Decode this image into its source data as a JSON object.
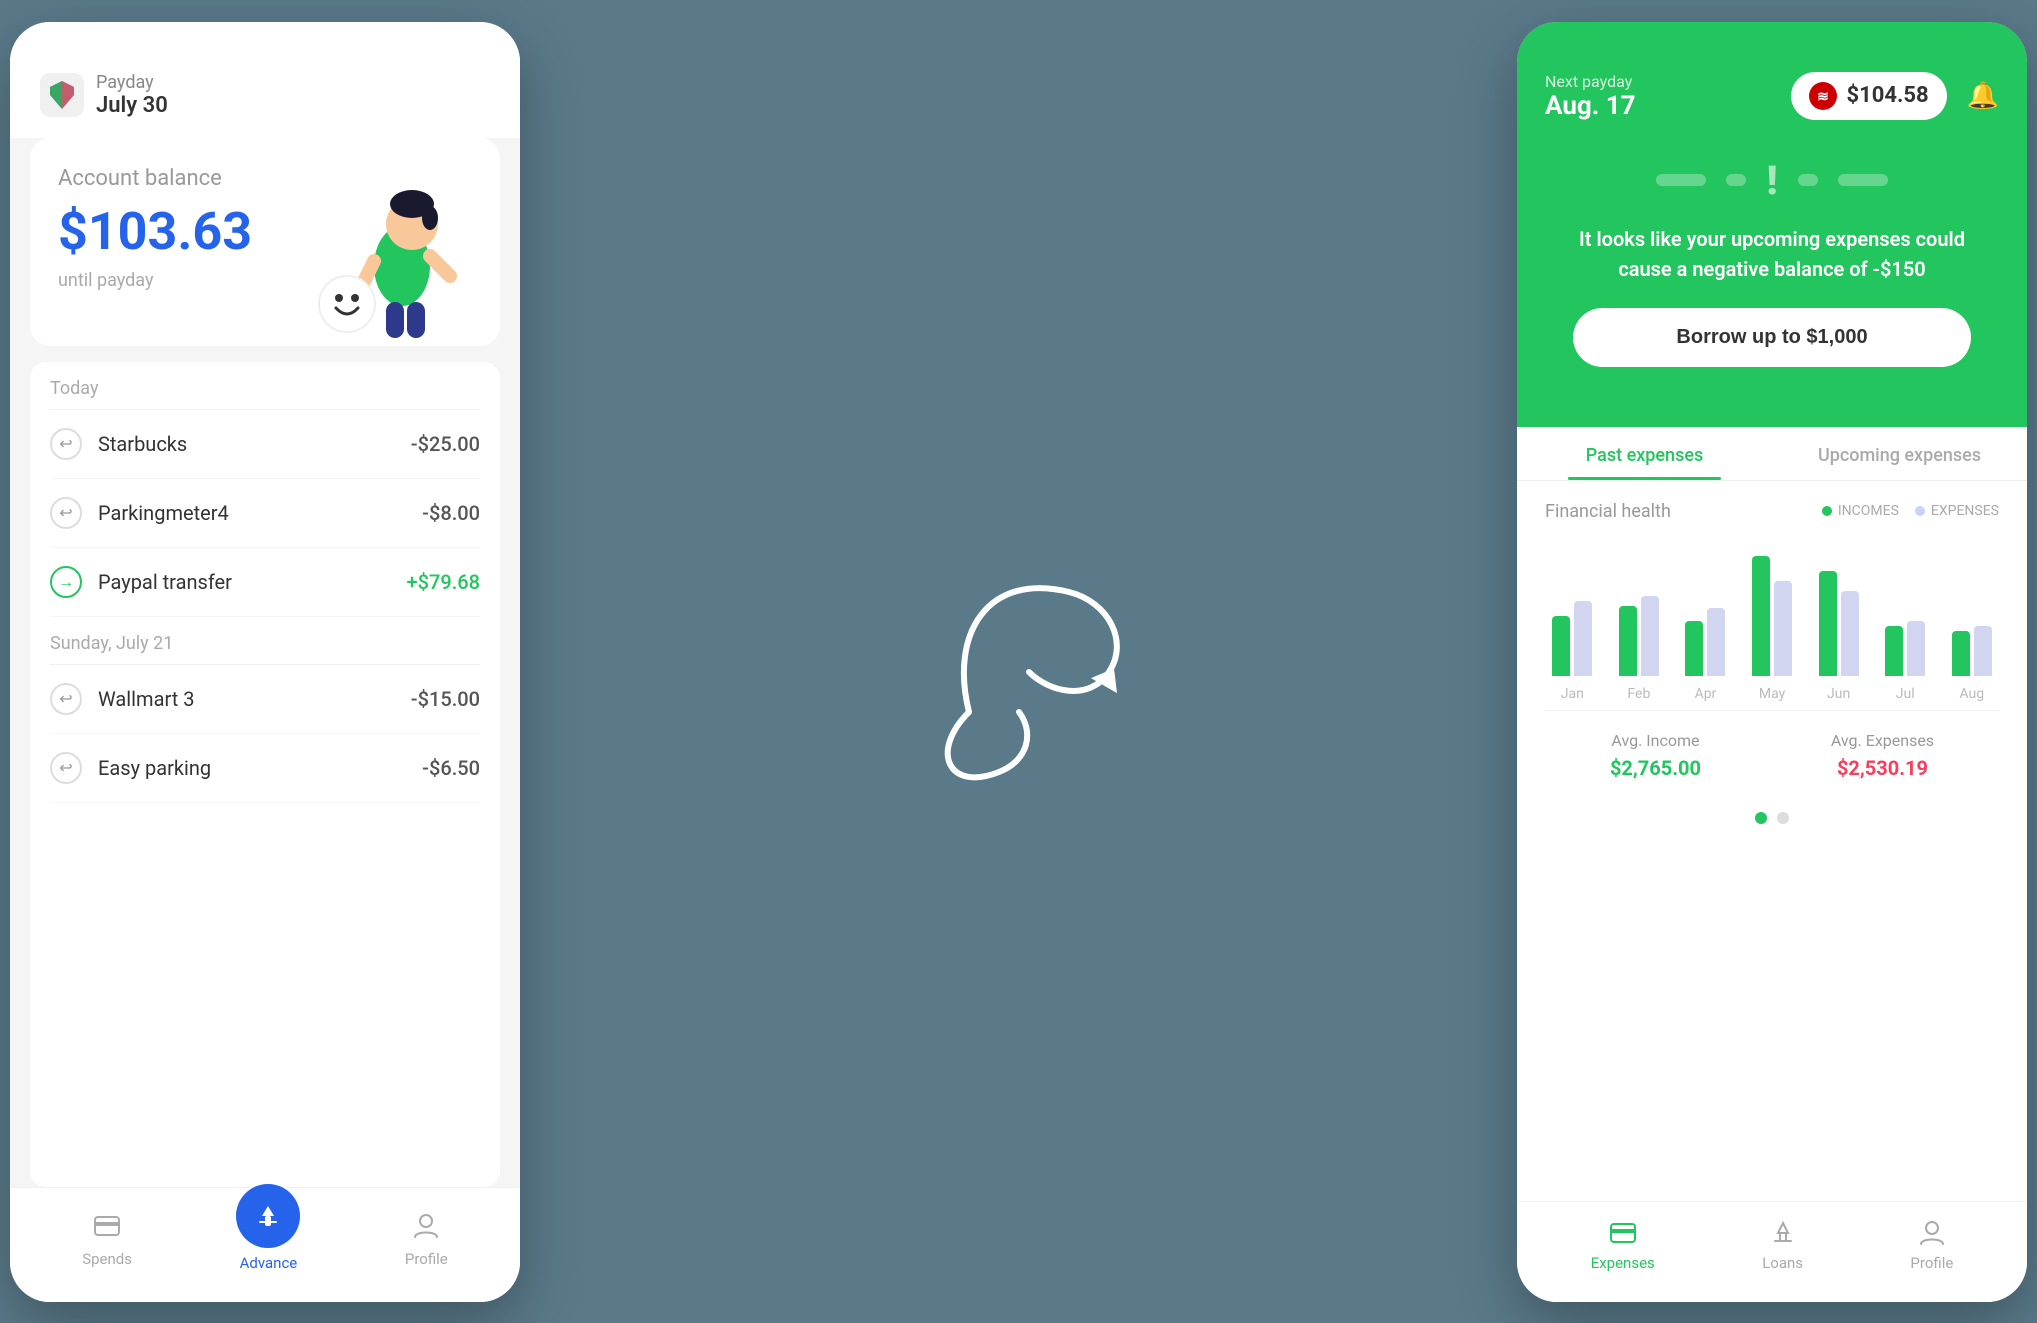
{
  "leftPhone": {
    "header": {
      "payday": "Payday",
      "date": "July 30"
    },
    "balanceCard": {
      "title": "Account balance",
      "amount": "$103.63",
      "subtitle": "until payday"
    },
    "sections": [
      {
        "label": "Today",
        "transactions": [
          {
            "name": "Starbucks",
            "amount": "-$25.00",
            "positive": false
          },
          {
            "name": "Parkingmeter4",
            "amount": "-$8.00",
            "positive": false
          },
          {
            "name": "Paypal transfer",
            "amount": "+$79.68",
            "positive": true
          }
        ]
      },
      {
        "label": "Sunday, July 21",
        "transactions": [
          {
            "name": "Wallmart 3",
            "amount": "-$15.00",
            "positive": false
          },
          {
            "name": "Easy parking",
            "amount": "-$6.50",
            "positive": false
          }
        ]
      }
    ],
    "bottomNav": {
      "items": [
        "Spends",
        "Advance",
        "Profile"
      ]
    }
  },
  "rightPhone": {
    "header": {
      "nextPaydayLabel": "Next payday",
      "date": "Aug. 17",
      "balance": "$104.58"
    },
    "warning": {
      "text": "It looks like your upcoming expenses could cause a negative balance of -$150",
      "buttonLabel": "Borrow up to $1,000"
    },
    "tabs": [
      "Past expenses",
      "Upcoming expenses"
    ],
    "chart": {
      "title": "Financial health",
      "legend": {
        "incomes": "INCOMES",
        "expenses": "EXPENSES"
      },
      "bars": [
        {
          "label": "Jan",
          "income": 60,
          "expense": 75
        },
        {
          "label": "Feb",
          "income": 70,
          "expense": 80
        },
        {
          "label": "Apr",
          "income": 55,
          "expense": 68
        },
        {
          "label": "May",
          "income": 110,
          "expense": 95
        },
        {
          "label": "Jun",
          "income": 100,
          "expense": 85
        },
        {
          "label": "Jul",
          "income": 50,
          "expense": 55
        },
        {
          "label": "Aug",
          "income": 48,
          "expense": 52
        }
      ],
      "avgIncome": {
        "label": "Avg. Income",
        "value": "$2,765.00"
      },
      "avgExpenses": {
        "label": "Avg. Expenses",
        "value": "$2,530.19"
      }
    },
    "bottomNav": {
      "items": [
        "Expenses",
        "Loans",
        "Profile"
      ]
    }
  },
  "arrow": {
    "description": "curved arrow pointing right"
  }
}
